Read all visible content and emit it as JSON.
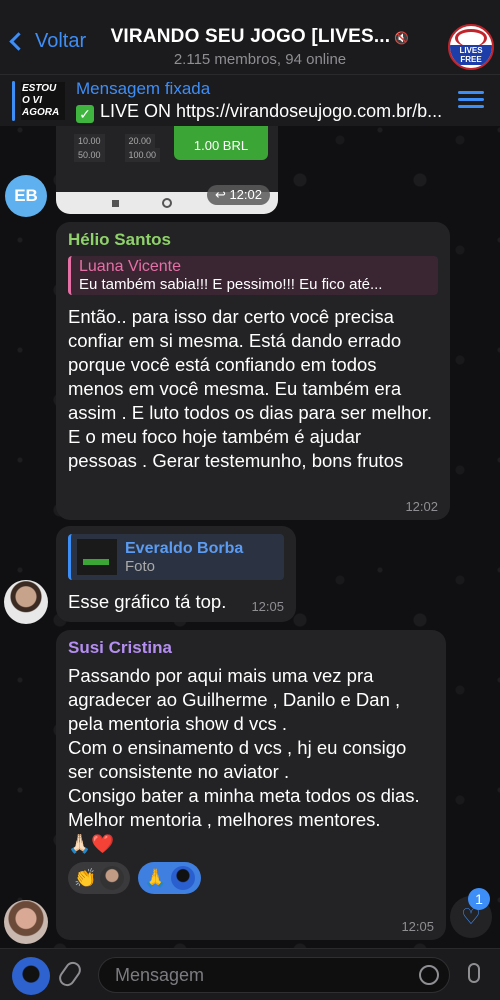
{
  "header": {
    "back_label": "Voltar",
    "title": "VIRANDO SEU JOGO [LIVES...",
    "subtitle": "2.115 membros, 94 online",
    "group_avatar_text": "LIVES FREE"
  },
  "pinned": {
    "label": "Mensagem fixada",
    "text": "LIVE ON https://virandoseujogo.com.br/b...",
    "thumb_text": "ESTOU\nO VI\nAGORA"
  },
  "image_message": {
    "numbers_row1": [
      "10.00",
      "20.00"
    ],
    "numbers_row2": [
      "50.00",
      "100.00"
    ],
    "green_button": "1.00 BRL",
    "time": "12:02"
  },
  "avatar_initials": "EB",
  "messages": [
    {
      "sender": "Hélio Santos",
      "reply_name": "Luana Vicente",
      "reply_text": "Eu também sabia!!! E pessimo!!! Eu fico até...",
      "text": "Então.. para isso dar certo você precisa confiar em si mesma. Está dando errado porque você está confiando em todos menos em você mesma. Eu também era assim . E luto todos os dias para ser melhor. E o meu foco hoje também é ajudar pessoas .  Gerar testemunho, bons frutos",
      "time": "12:02"
    },
    {
      "reply_name": "Everaldo Borba",
      "reply_text": "Foto",
      "text": "Esse gráfico tá top.",
      "time": "12:05"
    },
    {
      "sender": "Susi Cristina",
      "text": "Passando por aqui  mais uma vez pra agradecer ao Guilherme , Danilo e Dan , pela mentoria show d vcs .\nCom o ensinamento d vcs , hj eu consigo ser consistente no aviator .\nConsigo bater a minha meta todos os dias.\nMelhor mentoria , melhores mentores.",
      "emoji": "🙏🏻❤️",
      "reactions": [
        "👏",
        "🙏"
      ],
      "time": "12:05"
    }
  ],
  "scroll_badge": "1",
  "composer": {
    "placeholder": "Mensagem"
  },
  "colors": {
    "accent": "#3e8ef7",
    "helio": "#8fd16b",
    "luana": "#e570a5",
    "everaldo": "#5b9bf2",
    "susi": "#b48ef0"
  }
}
